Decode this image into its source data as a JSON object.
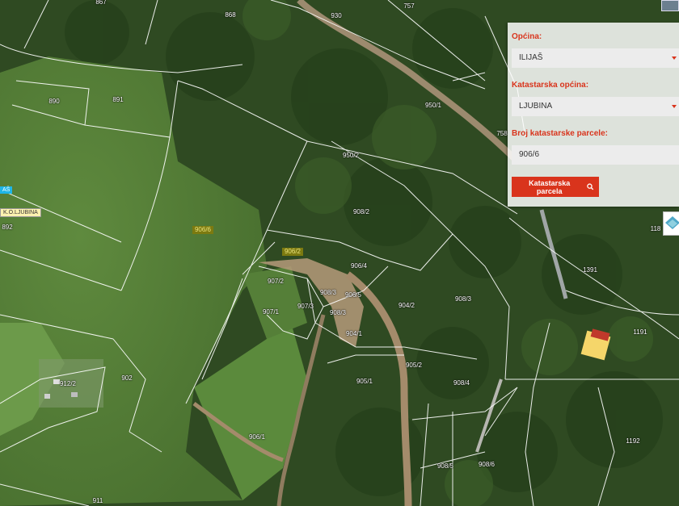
{
  "search_panel": {
    "municipality": {
      "label": "Općina:",
      "value": "ILIJAŠ"
    },
    "cadastral_municipality": {
      "label": "Katastarska općina:",
      "value": "LJUBINA"
    },
    "parcel_number": {
      "label": "Broj katastarske parcele:",
      "value": "906/6"
    },
    "search_button_label": "Katastarska parcela",
    "search_button_icon": "search-icon",
    "accent_color": "#d9341c"
  },
  "map": {
    "parcel_labels": [
      "867",
      "868",
      "930",
      "757",
      "890",
      "891",
      "950/1",
      "758",
      "950/2",
      "908/2",
      "892",
      "906/6",
      "906/2",
      "906/4",
      "907/2",
      "908/3",
      "906/5",
      "907/3",
      "908/3",
      "904/2",
      "908/3",
      "907/1",
      "904/1",
      "1191",
      "902",
      "905/2",
      "905/1",
      "908/4",
      "912/2",
      "906/1",
      "1192",
      "908/5",
      "908/6",
      "911",
      "1391",
      "118"
    ],
    "tags": {
      "left_blue": "AŠ",
      "ko_label": "K.O.LJUBINA"
    },
    "selected_parcel_color": "#7c7a10",
    "parcel_line_color": "#ffffff"
  },
  "controls": {
    "layers_icon": "layers-icon"
  }
}
